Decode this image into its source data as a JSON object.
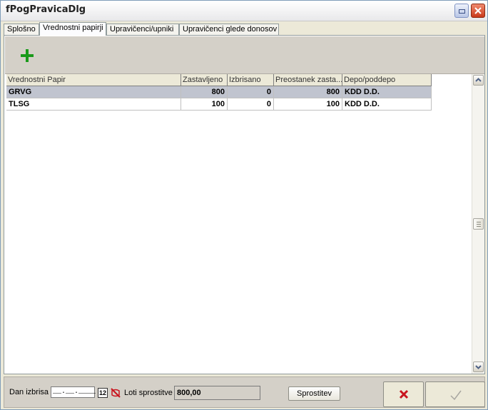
{
  "window": {
    "title": "fPogPravicaDlg"
  },
  "tabs": [
    {
      "label": "Splošno"
    },
    {
      "label": "Vrednostni papirji"
    },
    {
      "label": "Upravičenci/upniki"
    },
    {
      "label": "Upravičenci glede donosov"
    }
  ],
  "toolbar": {
    "add_icon": "plus-icon"
  },
  "table": {
    "columns": [
      "Vrednostni Papir",
      "Zastavljeno",
      "Izbrisano",
      "Preostanek zasta...",
      "Depo/poddepo"
    ],
    "rows": [
      {
        "papir": "GRVG",
        "zastavljeno": "800",
        "izbrisano": "0",
        "preostanek": "800",
        "depo": "KDD D.D."
      },
      {
        "papir": "TLSG",
        "zastavljeno": "100",
        "izbrisano": "0",
        "preostanek": "100",
        "depo": "KDD D.D."
      }
    ],
    "selected_row": 0
  },
  "footer": {
    "dan_izbrisa_label": "Dan izbrisa",
    "date_value": "__.__.____",
    "calendar_icon_text": "12",
    "loti_label": "Loti sprostitve",
    "loti_value": "800,00",
    "sprostitev_label": "Sprostitev"
  },
  "colors": {
    "accent_green": "#1a9a1a",
    "cancel_red": "#c8141e",
    "selection": "#c0c4cf"
  }
}
